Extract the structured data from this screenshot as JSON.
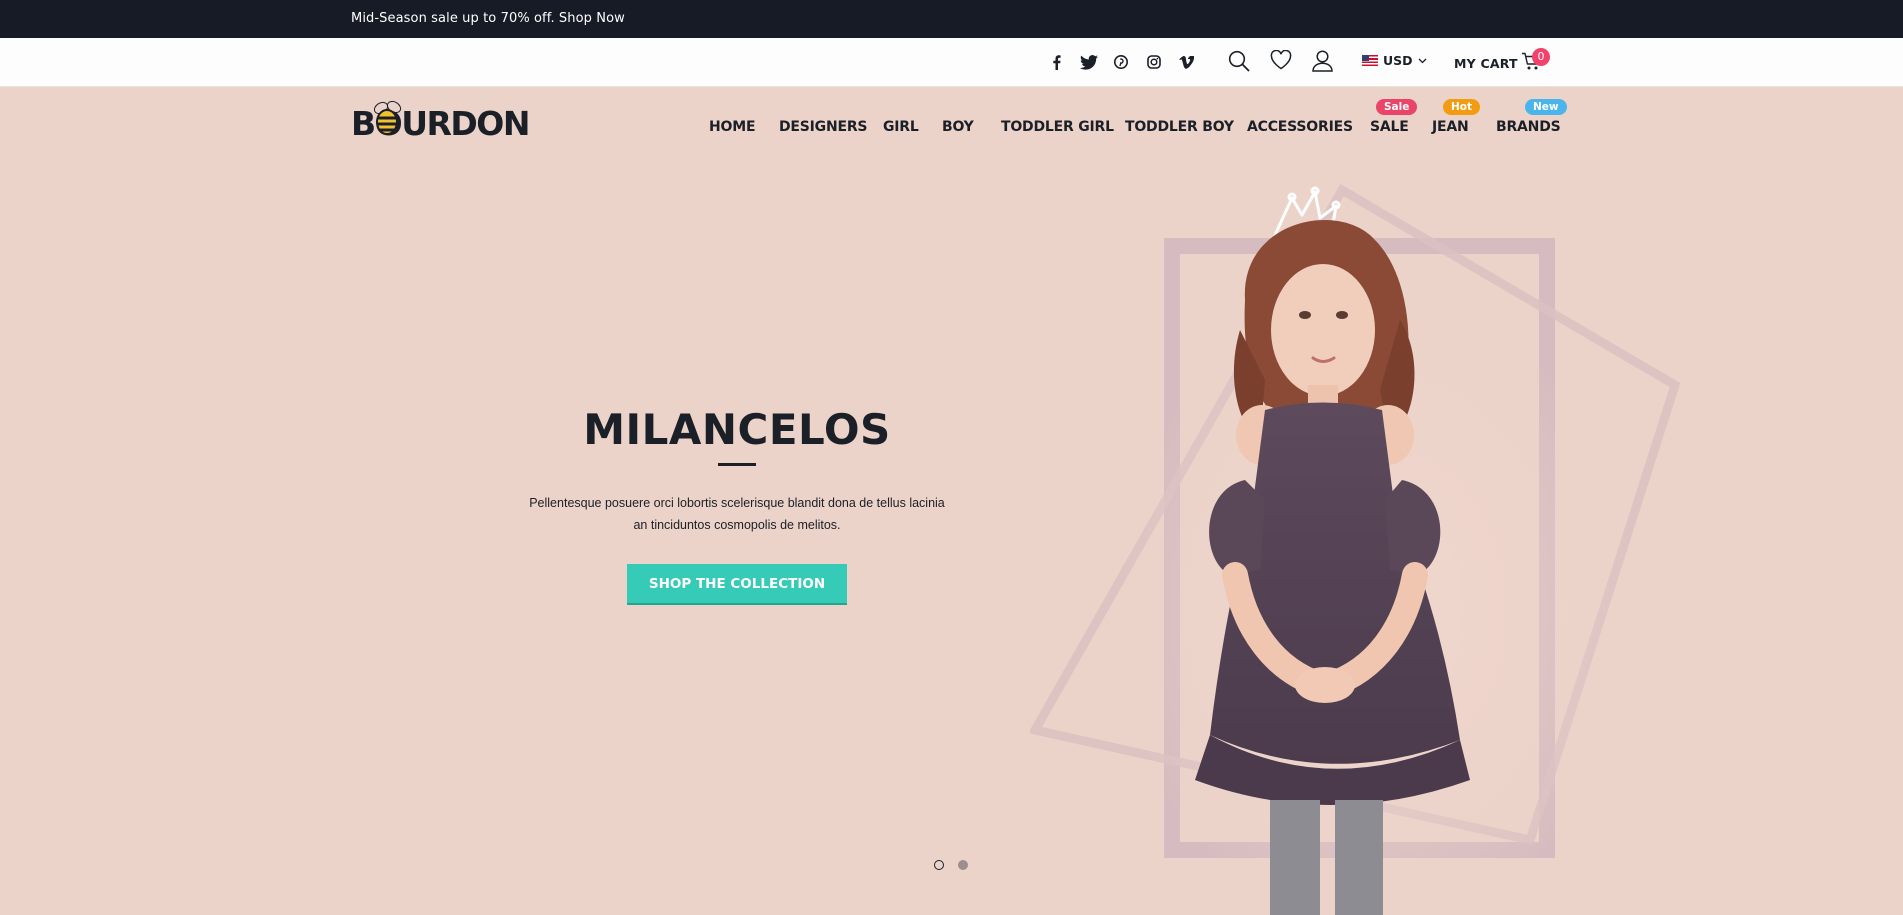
{
  "topbar": {
    "promo": "Mid-Season sale up to 70% off. Shop Now"
  },
  "utilbar": {
    "social": [
      "facebook-icon",
      "twitter-icon",
      "pinterest-icon",
      "instagram-icon",
      "vimeo-icon"
    ],
    "currency": "USD",
    "cart_label": "MY CART",
    "cart_count": "0"
  },
  "logo": {
    "text": "BOURDON"
  },
  "nav": {
    "items": [
      "HOME",
      "DESIGNERS",
      "GIRL",
      "BOY",
      "TODDLER GIRL",
      "TODDLER BOY",
      "ACCESSORIES",
      "SALE",
      "JEAN",
      "BRANDS"
    ],
    "badges": [
      {
        "label": "Sale",
        "color": "#ea4468"
      },
      {
        "label": "Hot",
        "color": "#f39c12"
      },
      {
        "label": "New",
        "color": "#4ab5ea"
      }
    ]
  },
  "hero": {
    "title": "MILANCELOS",
    "text_line1": "Pellentesque posuere orci lobortis scelerisque blandit dona de tellus lacinia",
    "text_line2": "an tinciduntos cosmopolis de melitos.",
    "button": "SHOP THE COLLECTION",
    "slides": 2,
    "active_slide": 1
  },
  "colors": {
    "accent": "#35cbb7",
    "background": "#ecd3c9",
    "topbar": "#161b26"
  }
}
